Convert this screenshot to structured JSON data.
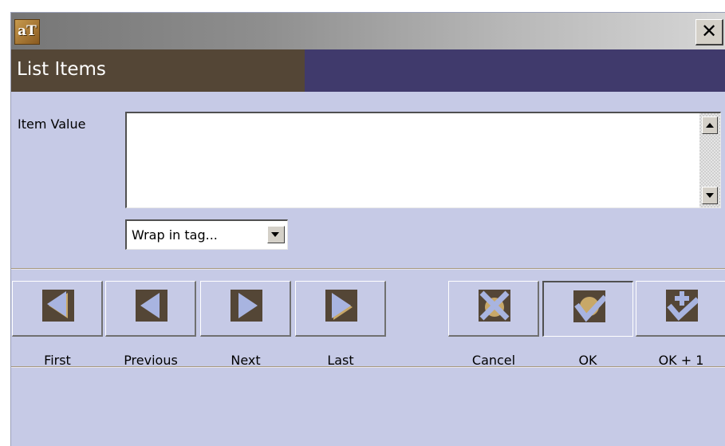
{
  "window": {
    "logo_text": "aT",
    "close_label": "✕"
  },
  "header": {
    "title": "List Items"
  },
  "form": {
    "item_value_label": "Item Value",
    "item_value": "",
    "wrap_select_value": "Wrap in tag..."
  },
  "navigation": [
    {
      "label": "First",
      "icon": "first-icon"
    },
    {
      "label": "Previous",
      "icon": "previous-icon"
    },
    {
      "label": "Next",
      "icon": "next-icon"
    },
    {
      "label": "Last",
      "icon": "last-icon"
    }
  ],
  "actions": [
    {
      "label": "Cancel",
      "icon": "cancel-icon"
    },
    {
      "label": "OK",
      "icon": "ok-icon"
    },
    {
      "label": "OK + 1",
      "icon": "ok-plus-one-icon"
    }
  ],
  "colors": {
    "background": "#c6cae6",
    "header_title_bg": "#544636",
    "header_band_bg": "#403a6c",
    "icon_dark": "#544636",
    "icon_light": "#a8b4e0",
    "icon_accent": "#c8a868"
  }
}
